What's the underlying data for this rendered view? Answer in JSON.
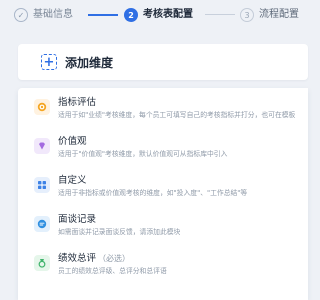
{
  "stepper": {
    "steps": [
      {
        "label": "基础信息",
        "number": "✓"
      },
      {
        "label": "考核表配置",
        "number": "2"
      },
      {
        "label": "流程配置",
        "number": "3"
      }
    ]
  },
  "add_button": {
    "label": "添加维度",
    "icon": "plus-icon"
  },
  "dimensions": [
    {
      "title": "指标评估",
      "desc": "适用于如\"业绩\"考核维度，每个员工可填写自己的考核指标并打分，也可在模板",
      "icon": "target-icon",
      "color": "#f5a623"
    },
    {
      "title": "价值观",
      "desc": "适用于\"价值观\"考核维度，默认价值观可从指标库中引入",
      "icon": "diamond-icon",
      "color": "#a36ae0"
    },
    {
      "title": "自定义",
      "desc": "适用于非指标或价值观考核的维度，如\"投入度\"、\"工作总结\"等",
      "icon": "grid-icon",
      "color": "#3d82e6"
    },
    {
      "title": "面谈记录",
      "desc": "如需面谈并记录面谈反馈，请添加此模块",
      "icon": "chat-icon",
      "color": "#2f8fe0"
    },
    {
      "title": "绩效总评",
      "note": "（必选）",
      "desc": "员工的绩效总评级、总评分和总评语",
      "icon": "medal-icon",
      "color": "#3fb36b"
    }
  ]
}
